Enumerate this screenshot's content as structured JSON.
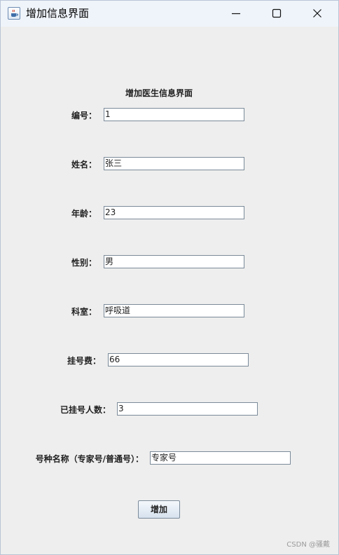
{
  "window": {
    "title": "增加信息界面",
    "app_icon": "java-cup-icon",
    "controls": [
      "minimize-icon",
      "maximize-icon",
      "close-icon"
    ]
  },
  "form": {
    "heading": "增加医生信息界面",
    "fields": [
      {
        "label": "编号：",
        "value": "1"
      },
      {
        "label": "姓名：",
        "value": "张三"
      },
      {
        "label": "年龄：",
        "value": "23"
      },
      {
        "label": "性别：",
        "value": "男"
      },
      {
        "label": "科室：",
        "value": "呼吸道"
      },
      {
        "label": "挂号费：",
        "value": "66"
      },
      {
        "label": "已挂号人数：",
        "value": "3"
      },
      {
        "label": "号种名称（专家号/普通号）：",
        "value": "专家号"
      }
    ],
    "submit_label": "增加"
  },
  "watermark": "CSDN @骚戴"
}
